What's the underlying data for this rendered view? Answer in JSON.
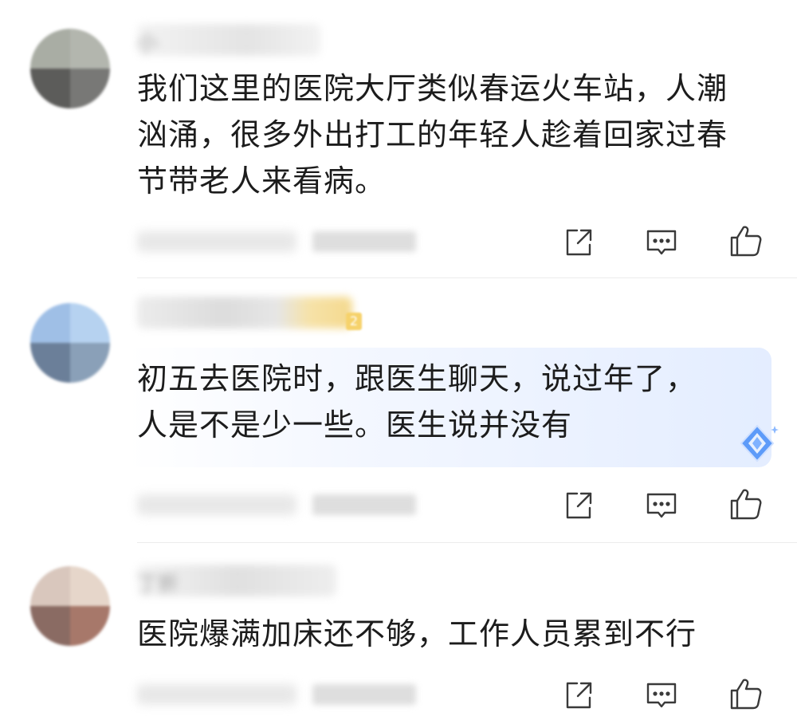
{
  "comments": [
    {
      "text": "我们这里的医院大厅类似春运火车站，人潮\n汹涌，很多外出打工的年轻人趁着回家过春\n节带老人来看病。",
      "username_stub": "小"
    },
    {
      "text": "初五去医院时，跟医生聊天，说过年了，\n人是不是少一些。医生说并没有",
      "username_stub": "",
      "badge": "2"
    },
    {
      "text": "医院爆满加床还不够，工作人员累到不行",
      "username_stub": "丁折"
    }
  ],
  "icons": {
    "share": "share-icon",
    "reply": "reply-icon",
    "like": "thumbs-up-icon",
    "ai": "ai-diamond-icon"
  },
  "colors": {
    "icon_stroke": "#3a3a3a",
    "text": "#1c1c1c",
    "highlight": "#e2ecff",
    "ai_blue": "#4a8cf7",
    "badge": "#f6d26b"
  }
}
